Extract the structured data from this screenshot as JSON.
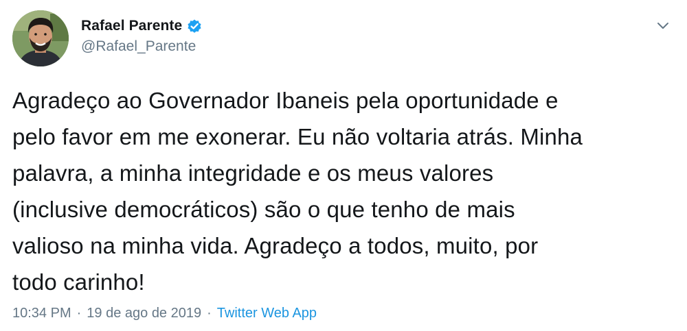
{
  "tweet": {
    "author": {
      "display_name": "Rafael Parente",
      "handle": "@Rafael_Parente",
      "verified": true
    },
    "text": "Agradeço ao Governador Ibaneis pela oportunidade e\npelo favor em me exonerar. Eu não voltaria atrás. Minha\npalavra, a minha integridade e os meus valores\n(inclusive democráticos) são o que tenho de mais\nvalioso na minha vida. Agradeço a todos, muito, por\ntodo carinho!",
    "time": "10:34 PM",
    "date": "19 de ago de 2019",
    "separator": "·",
    "source": "Twitter Web App"
  },
  "icons": {
    "verified": "verified-badge-icon",
    "menu": "chevron-down-icon"
  },
  "colors": {
    "text": "#14171a",
    "secondary": "#657786",
    "link": "#1b95e0",
    "verified": "#1da1f2"
  }
}
